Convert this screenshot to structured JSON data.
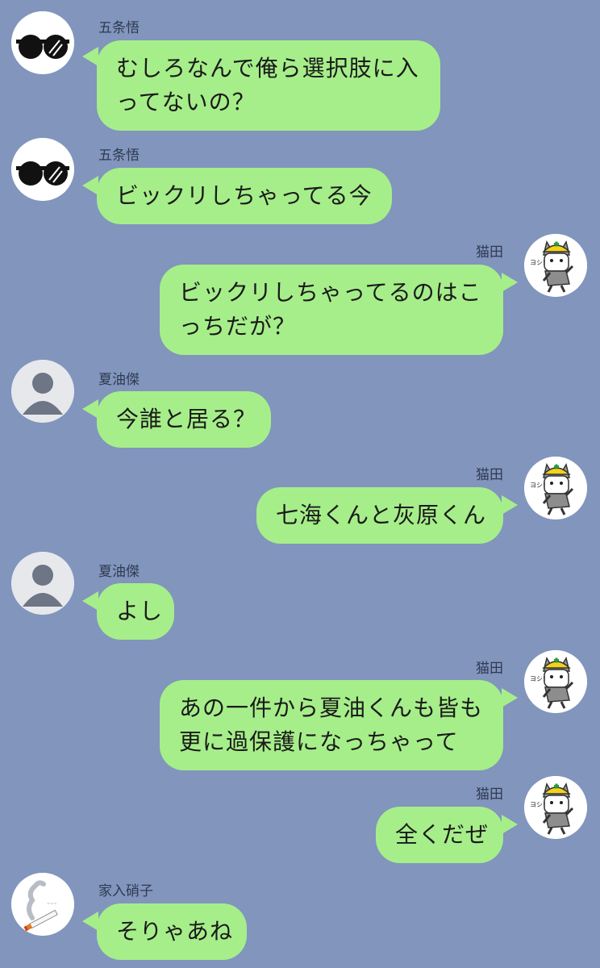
{
  "messages": [
    {
      "sender": "五条悟",
      "side": "left",
      "avatar": "sunglasses-icon",
      "lines": [
        "むしろなんで俺ら選択肢に入",
        "ってないの？"
      ]
    },
    {
      "sender": "五条悟",
      "side": "left",
      "avatar": "sunglasses-icon",
      "lines": [
        "ビックリしちゃってる今"
      ]
    },
    {
      "sender": "猫田",
      "side": "right",
      "avatar": "hardhat-cat-icon",
      "lines": [
        "ビックリしちゃってるのはこ",
        "っちだが？"
      ]
    },
    {
      "sender": "夏油傑",
      "side": "left",
      "avatar": "default-user-icon",
      "lines": [
        "今誰と居る？"
      ]
    },
    {
      "sender": "猫田",
      "side": "right",
      "avatar": "hardhat-cat-icon",
      "lines": [
        "七海くんと灰原くん"
      ]
    },
    {
      "sender": "夏油傑",
      "side": "left",
      "avatar": "default-user-icon",
      "lines": [
        "よし"
      ]
    },
    {
      "sender": "猫田",
      "side": "right",
      "avatar": "hardhat-cat-icon",
      "lines": [
        "あの一件から夏油くんも皆も",
        "更に過保護になっちゃって"
      ]
    },
    {
      "sender": "猫田",
      "side": "right",
      "avatar": "hardhat-cat-icon",
      "lines": [
        "全くだぜ"
      ]
    },
    {
      "sender": "家入硝子",
      "side": "left",
      "avatar": "cigarette-icon",
      "lines": [
        "そりゃあね"
      ]
    }
  ],
  "colors": {
    "background": "#8195bd",
    "bubble": "#a6ee8a",
    "name_text": "#2f3a52",
    "message_text": "#1a1a1a"
  }
}
